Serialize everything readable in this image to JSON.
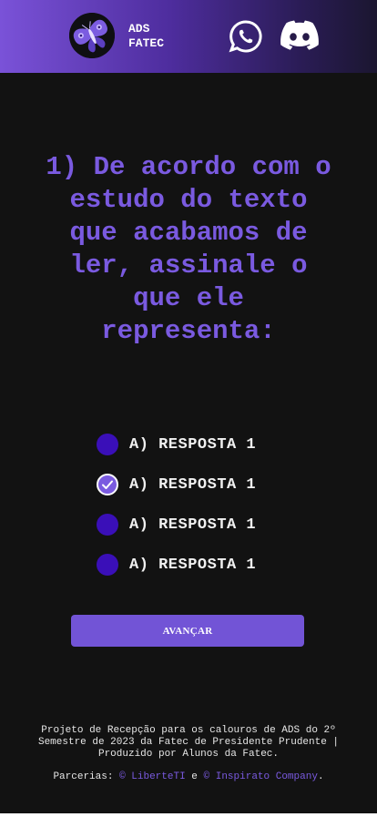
{
  "header": {
    "brand_line1": "ADS",
    "brand_line2": "FATEC",
    "logo_icon": "moth-icon",
    "whatsapp_icon": "whatsapp-icon",
    "discord_icon": "discord-icon"
  },
  "question": {
    "text": "1) De acordo com o estudo do texto que acabamos de ler, assinale o que ele representa:"
  },
  "options": [
    {
      "label": "A) RESPOSTA 1",
      "checked": false
    },
    {
      "label": "A) RESPOSTA 1",
      "checked": true
    },
    {
      "label": "A) RESPOSTA 1",
      "checked": false
    },
    {
      "label": "A) RESPOSTA 1",
      "checked": false
    }
  ],
  "button": {
    "label": "AVANÇAR"
  },
  "footer": {
    "text": "Projeto de Recepção para os calouros de ADS do 2º Semestre de 2023 da Fatec de Presidente Prudente | Produzido por Alunos da Fatec.",
    "partners_label": "Parcerias:",
    "partner1": "© LiberteTI",
    "connector": "e",
    "partner2": "© Inspirato Company",
    "end": "."
  },
  "colors": {
    "accent": "#7a5ae0",
    "radio_unchecked": "#3a0fb8",
    "background": "#121212",
    "button": "#7254d6"
  }
}
